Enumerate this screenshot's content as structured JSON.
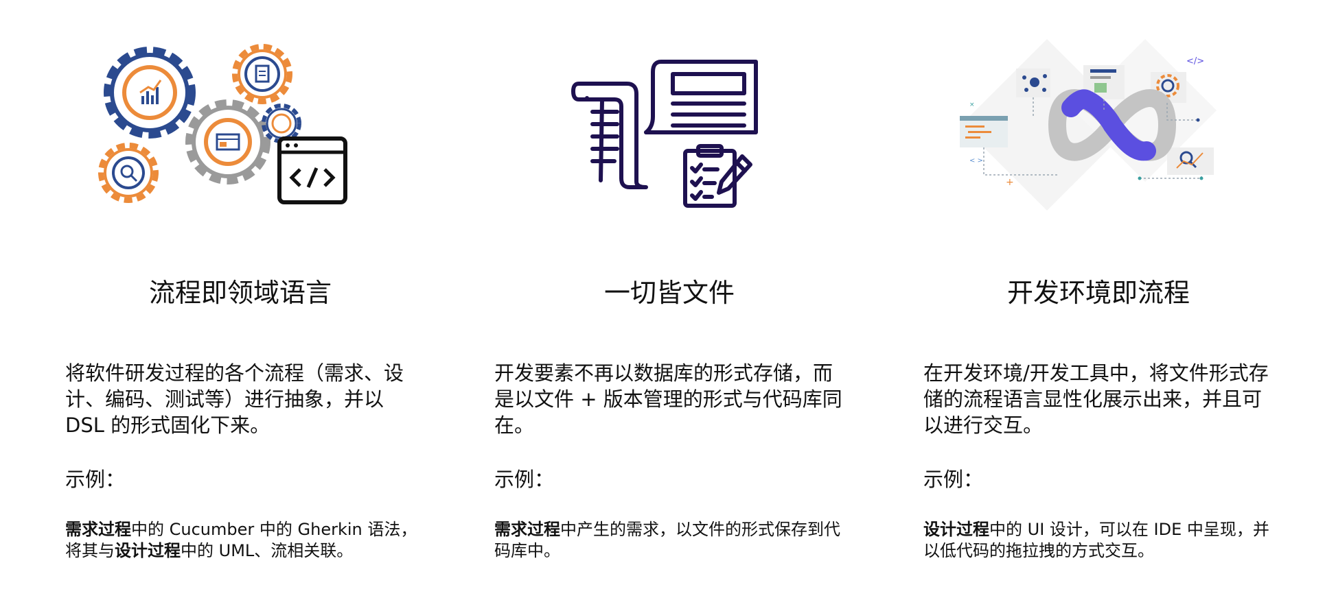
{
  "columns": [
    {
      "illustration_icon": "gears-process-icon",
      "title": "流程即领域语言",
      "description": "将软件研发过程的各个流程（需求、设计、编码、测试等）进行抽象，并以 DSL 的形式固化下来。",
      "example_label": "示例：",
      "example": {
        "bold_1": "需求过程",
        "text_1": "中的 Cucumber 中的 Gherkin 语法，将其与",
        "bold_2": "设计过程",
        "text_2": "中的 UML、流相关联。"
      }
    },
    {
      "illustration_icon": "documents-icon",
      "title": "一切皆文件",
      "description": "开发要素不再以数据库的形式存储，而是以文件 + 版本管理的形式与代码库同在。",
      "example_label": "示例：",
      "example": {
        "bold_1": "需求过程",
        "text_1": "中产生的需求，以文件的形式保存到代码库中。",
        "bold_2": "",
        "text_2": ""
      }
    },
    {
      "illustration_icon": "devops-infinity-icon",
      "title": "开发环境即流程",
      "description": "在开发环境/开发工具中，将文件形式存储的流程语言显性化展示出来，并且可以进行交互。",
      "example_label": "示例：",
      "example": {
        "bold_1": "设计过程",
        "text_1": "中的 UI 设计，可以在 IDE 中呈现，并以低代码的拖拉拽的方式交互。",
        "bold_2": "",
        "text_2": ""
      },
      "illustration_code_tag": "</>"
    }
  ],
  "colors": {
    "navy": "#2b4a8f",
    "orange": "#ec8b3a",
    "gray": "#9a9a9a",
    "dark_purple": "#1e1150",
    "infinity_purple": "#5b4fe0",
    "infinity_gray": "#c4c4c4"
  }
}
